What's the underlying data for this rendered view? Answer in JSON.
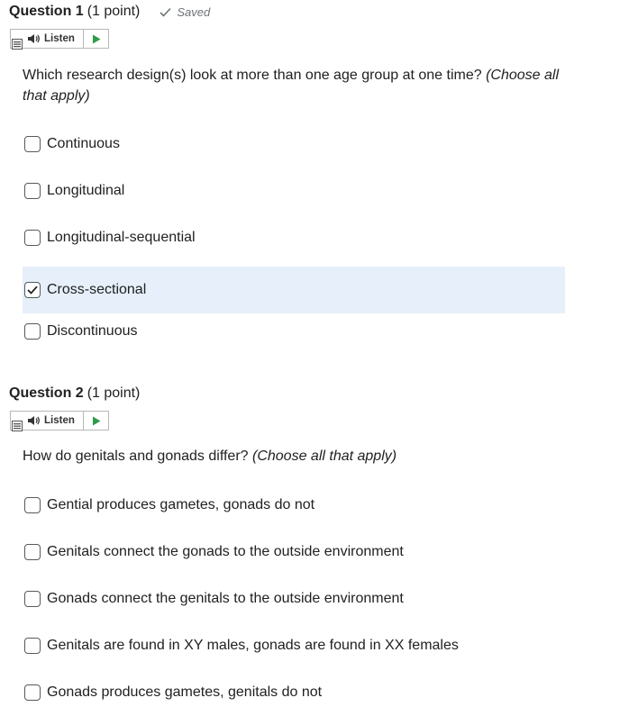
{
  "questions": [
    {
      "title": "Question 1",
      "points": "(1 point)",
      "status": "Saved",
      "listen_label": "Listen",
      "prompt": "Which research design(s) look at more than one age group at one time?",
      "hint": "(Choose all that apply)",
      "options": [
        {
          "label": "Continuous",
          "checked": false
        },
        {
          "label": "Longitudinal",
          "checked": false
        },
        {
          "label": "Longitudinal-sequential",
          "checked": false
        },
        {
          "label": "Cross-sectional",
          "checked": true
        },
        {
          "label": "Discontinuous",
          "checked": false
        }
      ]
    },
    {
      "title": "Question 2",
      "points": "(1 point)",
      "listen_label": "Listen",
      "prompt": "How do genitals and gonads differ?",
      "hint": "(Choose all that apply)",
      "options": [
        {
          "label": "Gential produces gametes, gonads do not",
          "checked": false
        },
        {
          "label": "Genitals connect the gonads to the outside environment",
          "checked": false
        },
        {
          "label": "Gonads connect the genitals to the outside environment",
          "checked": false
        },
        {
          "label": "Genitals are found in XY males, gonads are found in XX females",
          "checked": false
        },
        {
          "label": "Gonads produces gametes, genitals do not",
          "checked": false
        }
      ]
    }
  ],
  "colors": {
    "selected_bg": "#e7f0fa",
    "play_green": "#2e9b4a",
    "text": "#202122"
  }
}
